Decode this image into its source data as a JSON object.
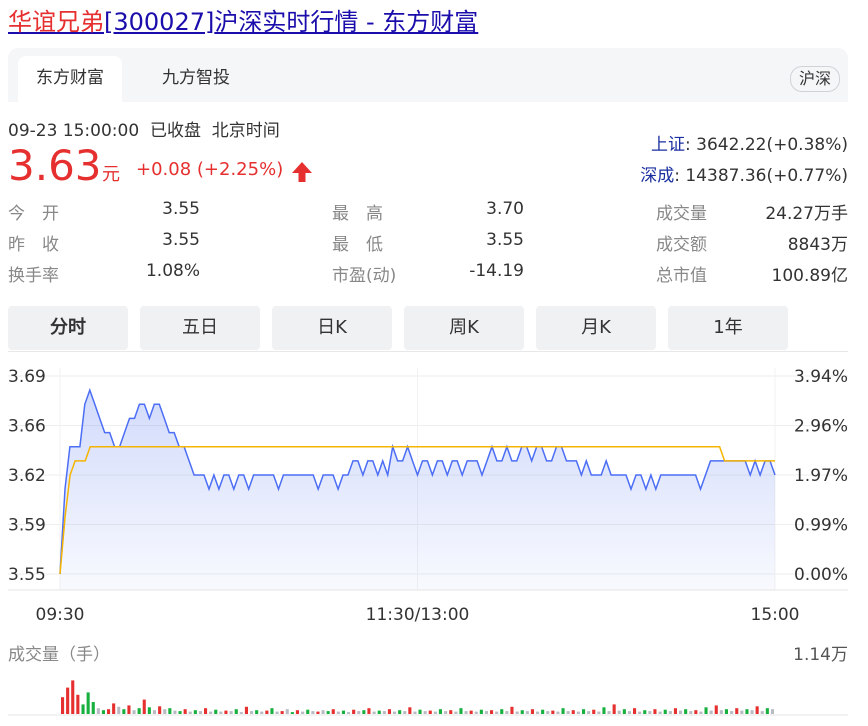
{
  "page": {
    "title_name": "华谊兄弟",
    "title_code": "[300027]",
    "title_rest": "沪深实时行情 - 东方财富"
  },
  "tabs": [
    {
      "label": "东方财富",
      "active": true
    },
    {
      "label": "九方智投",
      "active": false
    }
  ],
  "market_tag": "沪深",
  "quote": {
    "datetime": "09-23 15:00:00",
    "status": "已收盘",
    "timezone": "北京时间",
    "price": "3.63",
    "unit": "元",
    "change": "+0.08",
    "change_pct": "(+2.25%)",
    "direction": "up"
  },
  "indices": [
    {
      "name": "上证",
      "value": ": 3642.22(+0.38%)"
    },
    {
      "name": "深成",
      "value": ": 14387.36(+0.77%)"
    }
  ],
  "stats": {
    "open_label": "今　开",
    "open": "3.55",
    "prev_label": "昨　收",
    "prev": "3.55",
    "turnover_label": "换手率",
    "turnover": "1.08%",
    "high_label": "最　高",
    "high": "3.70",
    "low_label": "最　低",
    "low": "3.55",
    "pe_label": "市盈(动)",
    "pe": "-14.19",
    "volume_label": "成交量",
    "volume": "24.27万手",
    "amount_label": "成交额",
    "amount": "8843万",
    "mcap_label": "总市值",
    "mcap": "100.89亿"
  },
  "periods": [
    {
      "label": "分时",
      "active": true
    },
    {
      "label": "五日",
      "active": false
    },
    {
      "label": "日K",
      "active": false
    },
    {
      "label": "周K",
      "active": false
    },
    {
      "label": "月K",
      "active": false
    },
    {
      "label": "1年",
      "active": false
    }
  ],
  "chart_data": {
    "type": "line",
    "x_ticks": [
      "09:30",
      "11:30/13:00",
      "15:00"
    ],
    "y_left_ticks": [
      "3.69",
      "3.66",
      "3.62",
      "3.59",
      "3.55"
    ],
    "y_right_ticks": [
      "3.94%",
      "2.96%",
      "1.97%",
      "0.99%",
      "0.00%"
    ],
    "ylim": [
      3.55,
      3.69
    ],
    "price_color": "#4c6ef5",
    "avg_color": "#f5b400",
    "price_series": [
      3.55,
      3.61,
      3.64,
      3.64,
      3.64,
      3.67,
      3.68,
      3.67,
      3.66,
      3.65,
      3.65,
      3.64,
      3.64,
      3.65,
      3.66,
      3.66,
      3.67,
      3.67,
      3.66,
      3.67,
      3.67,
      3.66,
      3.65,
      3.65,
      3.64,
      3.64,
      3.63,
      3.62,
      3.62,
      3.62,
      3.61,
      3.62,
      3.61,
      3.62,
      3.62,
      3.61,
      3.62,
      3.62,
      3.61,
      3.62,
      3.62,
      3.62,
      3.62,
      3.62,
      3.61,
      3.62,
      3.62,
      3.62,
      3.62,
      3.62,
      3.62,
      3.62,
      3.61,
      3.62,
      3.62,
      3.62,
      3.61,
      3.62,
      3.62,
      3.63,
      3.63,
      3.62,
      3.63,
      3.63,
      3.62,
      3.63,
      3.62,
      3.64,
      3.63,
      3.63,
      3.64,
      3.63,
      3.62,
      3.63,
      3.63,
      3.62,
      3.63,
      3.63,
      3.62,
      3.63,
      3.63,
      3.62,
      3.63,
      3.63,
      3.63,
      3.62,
      3.63,
      3.64,
      3.63,
      3.63,
      3.64,
      3.63,
      3.63,
      3.64,
      3.64,
      3.63,
      3.64,
      3.64,
      3.63,
      3.63,
      3.64,
      3.64,
      3.63,
      3.63,
      3.63,
      3.62,
      3.63,
      3.62,
      3.62,
      3.62,
      3.63,
      3.62,
      3.62,
      3.62,
      3.62,
      3.61,
      3.62,
      3.62,
      3.61,
      3.62,
      3.61,
      3.62,
      3.62,
      3.62,
      3.62,
      3.62,
      3.62,
      3.62,
      3.62,
      3.61,
      3.62,
      3.63,
      3.63,
      3.63,
      3.63,
      3.63,
      3.63,
      3.63,
      3.63,
      3.62,
      3.63,
      3.62,
      3.63,
      3.63,
      3.62
    ],
    "avg_series": [
      3.55,
      3.59,
      3.62,
      3.63,
      3.63,
      3.63,
      3.64,
      3.64,
      3.64,
      3.64,
      3.64,
      3.64,
      3.64,
      3.64,
      3.64,
      3.64,
      3.64,
      3.64,
      3.64,
      3.64,
      3.64,
      3.64,
      3.64,
      3.64,
      3.64,
      3.64,
      3.64,
      3.64,
      3.64,
      3.64,
      3.64,
      3.64,
      3.64,
      3.64,
      3.64,
      3.64,
      3.64,
      3.64,
      3.64,
      3.64,
      3.64,
      3.64,
      3.64,
      3.64,
      3.64,
      3.64,
      3.64,
      3.64,
      3.64,
      3.64,
      3.64,
      3.64,
      3.64,
      3.64,
      3.64,
      3.64,
      3.64,
      3.64,
      3.64,
      3.64,
      3.64,
      3.64,
      3.64,
      3.64,
      3.64,
      3.64,
      3.64,
      3.64,
      3.64,
      3.64,
      3.64,
      3.64,
      3.64,
      3.64,
      3.64,
      3.64,
      3.64,
      3.64,
      3.64,
      3.64,
      3.64,
      3.64,
      3.64,
      3.64,
      3.64,
      3.64,
      3.64,
      3.64,
      3.64,
      3.64,
      3.64,
      3.64,
      3.64,
      3.64,
      3.64,
      3.64,
      3.64,
      3.64,
      3.64,
      3.64,
      3.64,
      3.64,
      3.64,
      3.64,
      3.64,
      3.64,
      3.64,
      3.64,
      3.64,
      3.64,
      3.64,
      3.64,
      3.64,
      3.64,
      3.64,
      3.64,
      3.64,
      3.64,
      3.64,
      3.64,
      3.64,
      3.64,
      3.64,
      3.64,
      3.64,
      3.64,
      3.64,
      3.64,
      3.64,
      3.64,
      3.64,
      3.64,
      3.63,
      3.63,
      3.63,
      3.63,
      3.63,
      3.63,
      3.63,
      3.63,
      3.63,
      3.63,
      3.63
    ]
  },
  "volume_chart": {
    "label": "成交量（手）",
    "max_label": "1.14万",
    "up_color": "#e62f2f",
    "down_color": "#17b03e",
    "flat_color": "#b8bcc2",
    "bars": [
      {
        "v": 0.35,
        "c": "up"
      },
      {
        "v": 0.55,
        "c": "up"
      },
      {
        "v": 0.7,
        "c": "up"
      },
      {
        "v": 0.4,
        "c": "up"
      },
      {
        "v": 0.2,
        "c": "down"
      },
      {
        "v": 0.45,
        "c": "down"
      },
      {
        "v": 0.25,
        "c": "down"
      },
      {
        "v": 0.12,
        "c": "flat"
      },
      {
        "v": 0.08,
        "c": "down"
      },
      {
        "v": 0.1,
        "c": "up"
      },
      {
        "v": 0.22,
        "c": "up"
      },
      {
        "v": 0.15,
        "c": "flat"
      },
      {
        "v": 0.1,
        "c": "down"
      },
      {
        "v": 0.18,
        "c": "up"
      },
      {
        "v": 0.08,
        "c": "flat"
      },
      {
        "v": 0.12,
        "c": "down"
      },
      {
        "v": 0.3,
        "c": "up"
      },
      {
        "v": 0.14,
        "c": "down"
      },
      {
        "v": 0.08,
        "c": "flat"
      },
      {
        "v": 0.16,
        "c": "up"
      },
      {
        "v": 0.1,
        "c": "flat"
      },
      {
        "v": 0.12,
        "c": "down"
      },
      {
        "v": 0.07,
        "c": "flat"
      },
      {
        "v": 0.06,
        "c": "down"
      },
      {
        "v": 0.1,
        "c": "up"
      },
      {
        "v": 0.05,
        "c": "flat"
      },
      {
        "v": 0.08,
        "c": "down"
      },
      {
        "v": 0.06,
        "c": "flat"
      },
      {
        "v": 0.12,
        "c": "up"
      },
      {
        "v": 0.05,
        "c": "flat"
      },
      {
        "v": 0.09,
        "c": "down"
      },
      {
        "v": 0.05,
        "c": "flat"
      },
      {
        "v": 0.07,
        "c": "up"
      },
      {
        "v": 0.06,
        "c": "flat"
      },
      {
        "v": 0.1,
        "c": "down"
      },
      {
        "v": 0.04,
        "c": "flat"
      },
      {
        "v": 0.15,
        "c": "up"
      },
      {
        "v": 0.06,
        "c": "flat"
      },
      {
        "v": 0.08,
        "c": "down"
      },
      {
        "v": 0.05,
        "c": "flat"
      },
      {
        "v": 0.07,
        "c": "up"
      },
      {
        "v": 0.12,
        "c": "down"
      },
      {
        "v": 0.05,
        "c": "flat"
      },
      {
        "v": 0.06,
        "c": "up"
      },
      {
        "v": 0.1,
        "c": "flat"
      },
      {
        "v": 0.04,
        "c": "down"
      },
      {
        "v": 0.08,
        "c": "up"
      },
      {
        "v": 0.05,
        "c": "flat"
      },
      {
        "v": 0.09,
        "c": "down"
      },
      {
        "v": 0.06,
        "c": "flat"
      },
      {
        "v": 0.05,
        "c": "up"
      },
      {
        "v": 0.08,
        "c": "flat"
      },
      {
        "v": 0.06,
        "c": "down"
      },
      {
        "v": 0.1,
        "c": "up"
      },
      {
        "v": 0.05,
        "c": "flat"
      },
      {
        "v": 0.07,
        "c": "down"
      },
      {
        "v": 0.04,
        "c": "flat"
      },
      {
        "v": 0.09,
        "c": "up"
      },
      {
        "v": 0.06,
        "c": "flat"
      },
      {
        "v": 0.08,
        "c": "down"
      },
      {
        "v": 0.12,
        "c": "up"
      },
      {
        "v": 0.05,
        "c": "flat"
      },
      {
        "v": 0.07,
        "c": "down"
      },
      {
        "v": 0.06,
        "c": "flat"
      },
      {
        "v": 0.1,
        "c": "up"
      },
      {
        "v": 0.05,
        "c": "flat"
      },
      {
        "v": 0.08,
        "c": "down"
      },
      {
        "v": 0.06,
        "c": "flat"
      },
      {
        "v": 0.14,
        "c": "up"
      },
      {
        "v": 0.05,
        "c": "flat"
      },
      {
        "v": 0.09,
        "c": "down"
      },
      {
        "v": 0.06,
        "c": "flat"
      },
      {
        "v": 0.07,
        "c": "up"
      },
      {
        "v": 0.05,
        "c": "flat"
      },
      {
        "v": 0.1,
        "c": "down"
      },
      {
        "v": 0.06,
        "c": "flat"
      },
      {
        "v": 0.08,
        "c": "up"
      },
      {
        "v": 0.05,
        "c": "flat"
      },
      {
        "v": 0.12,
        "c": "down"
      },
      {
        "v": 0.06,
        "c": "flat"
      },
      {
        "v": 0.07,
        "c": "up"
      },
      {
        "v": 0.05,
        "c": "flat"
      },
      {
        "v": 0.09,
        "c": "down"
      },
      {
        "v": 0.06,
        "c": "flat"
      },
      {
        "v": 0.08,
        "c": "up"
      },
      {
        "v": 0.05,
        "c": "flat"
      },
      {
        "v": 0.1,
        "c": "down"
      },
      {
        "v": 0.06,
        "c": "flat"
      },
      {
        "v": 0.15,
        "c": "up"
      },
      {
        "v": 0.05,
        "c": "flat"
      },
      {
        "v": 0.08,
        "c": "down"
      },
      {
        "v": 0.06,
        "c": "flat"
      },
      {
        "v": 0.1,
        "c": "up"
      },
      {
        "v": 0.05,
        "c": "flat"
      },
      {
        "v": 0.09,
        "c": "down"
      },
      {
        "v": 0.06,
        "c": "flat"
      },
      {
        "v": 0.07,
        "c": "up"
      },
      {
        "v": 0.05,
        "c": "flat"
      },
      {
        "v": 0.12,
        "c": "down"
      },
      {
        "v": 0.06,
        "c": "flat"
      },
      {
        "v": 0.08,
        "c": "up"
      },
      {
        "v": 0.05,
        "c": "flat"
      },
      {
        "v": 0.1,
        "c": "down"
      },
      {
        "v": 0.06,
        "c": "flat"
      },
      {
        "v": 0.09,
        "c": "up"
      },
      {
        "v": 0.05,
        "c": "flat"
      },
      {
        "v": 0.14,
        "c": "down"
      },
      {
        "v": 0.06,
        "c": "flat"
      },
      {
        "v": 0.2,
        "c": "up"
      },
      {
        "v": 0.07,
        "c": "flat"
      },
      {
        "v": 0.1,
        "c": "down"
      },
      {
        "v": 0.06,
        "c": "flat"
      },
      {
        "v": 0.12,
        "c": "up"
      },
      {
        "v": 0.05,
        "c": "flat"
      },
      {
        "v": 0.08,
        "c": "down"
      },
      {
        "v": 0.06,
        "c": "flat"
      },
      {
        "v": 0.1,
        "c": "up"
      },
      {
        "v": 0.05,
        "c": "flat"
      },
      {
        "v": 0.09,
        "c": "down"
      },
      {
        "v": 0.06,
        "c": "flat"
      },
      {
        "v": 0.12,
        "c": "up"
      },
      {
        "v": 0.07,
        "c": "flat"
      },
      {
        "v": 0.1,
        "c": "down"
      },
      {
        "v": 0.06,
        "c": "flat"
      },
      {
        "v": 0.08,
        "c": "up"
      },
      {
        "v": 0.05,
        "c": "flat"
      },
      {
        "v": 0.14,
        "c": "down"
      },
      {
        "v": 0.07,
        "c": "flat"
      },
      {
        "v": 0.18,
        "c": "up"
      },
      {
        "v": 0.08,
        "c": "flat"
      },
      {
        "v": 0.1,
        "c": "down"
      },
      {
        "v": 0.06,
        "c": "flat"
      },
      {
        "v": 0.12,
        "c": "up"
      },
      {
        "v": 0.07,
        "c": "flat"
      },
      {
        "v": 0.1,
        "c": "down"
      },
      {
        "v": 0.08,
        "c": "flat"
      },
      {
        "v": 0.16,
        "c": "up"
      },
      {
        "v": 0.06,
        "c": "flat"
      },
      {
        "v": 0.12,
        "c": "down"
      },
      {
        "v": 0.1,
        "c": "flat"
      }
    ]
  }
}
